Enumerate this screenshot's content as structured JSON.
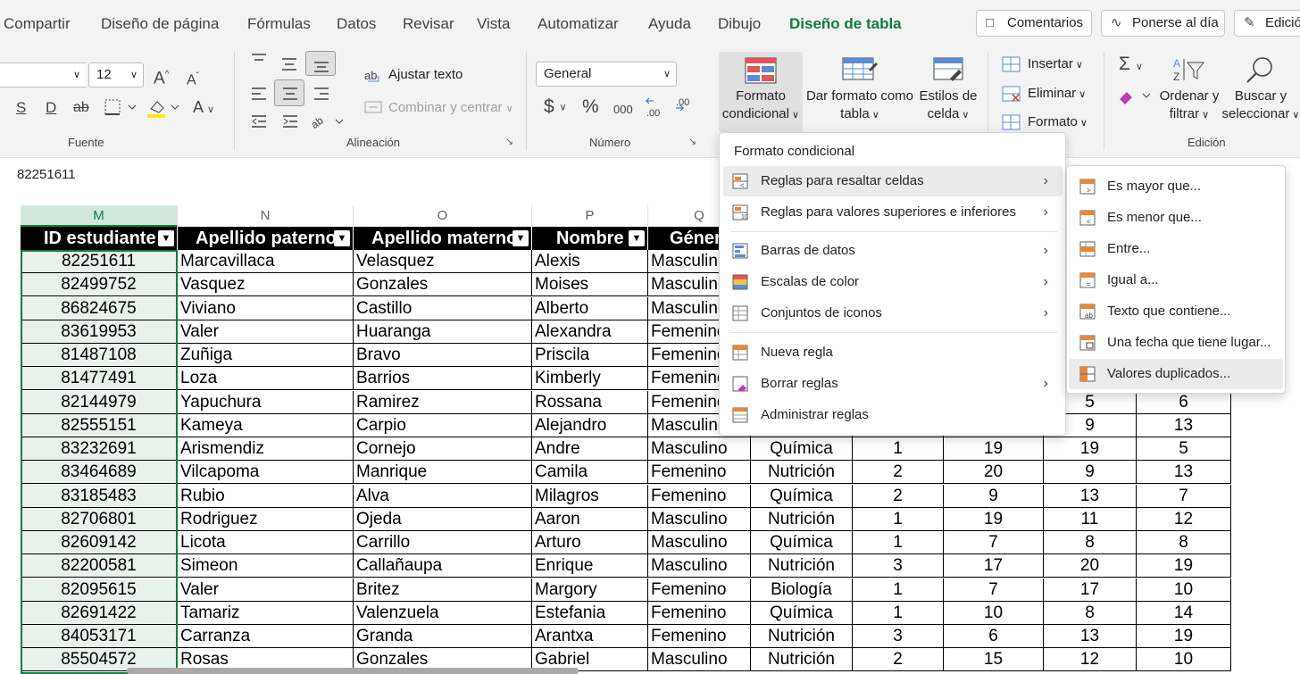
{
  "menubar": {
    "tabs": [
      "Compartir",
      "Diseño de página",
      "Fórmulas",
      "Datos",
      "Revisar",
      "Vista",
      "Automatizar",
      "Ayuda",
      "Dibujo",
      "Diseño de tabla"
    ],
    "active_tab": "Diseño de tabla",
    "comments_label": "Comentarios",
    "catchup_label": "Ponerse al día",
    "edit_label": "Edición"
  },
  "ribbon": {
    "font": {
      "name_value": "",
      "size_value": "12",
      "grow_glyph": "A",
      "shrink_glyph": "A",
      "underline_glyph": "S",
      "double_underline_glyph": "D",
      "strike_glyph": "ab",
      "font_color_glyph": "A",
      "group_label": "Fuente"
    },
    "alignment": {
      "wrap_text": "Ajustar texto",
      "merge_center": "Combinar y centrar",
      "group_label": "Alineación"
    },
    "number": {
      "format_value": "General",
      "currency_glyph": "$",
      "percent_glyph": "%",
      "thousands_glyph": "000",
      "group_label": "Número"
    },
    "styles": {
      "conditional_line1": "Formato",
      "conditional_line2": "condicional",
      "format_table_line1": "Dar formato como",
      "format_table_line2": "tabla",
      "cell_styles_line1": "Estilos de",
      "cell_styles_line2": "celda"
    },
    "cells": {
      "insert": "Insertar",
      "delete": "Eliminar",
      "format": "Formato"
    },
    "editing": {
      "sort_line1": "Ordenar y",
      "sort_line2": "filtrar",
      "find_line1": "Buscar y",
      "find_line2": "seleccionar",
      "group_label": "Edición"
    }
  },
  "formula_bar": {
    "value": "82251611"
  },
  "grid": {
    "columns": [
      "M",
      "N",
      "O",
      "P",
      "Q"
    ],
    "selected_column": "M",
    "headers": [
      "ID estudiante",
      "Apellido paterno",
      "Apellido materno",
      "Nombre",
      "Género"
    ],
    "rows": [
      [
        "82251611",
        "Marcavillaca",
        "Velasquez",
        "Alexis",
        "Masculino",
        "",
        "",
        "",
        "",
        ""
      ],
      [
        "82499752",
        "Vasquez",
        "Gonzales",
        "Moises",
        "Masculino",
        "",
        "",
        "",
        "",
        ""
      ],
      [
        "86824675",
        "Viviano",
        "Castillo",
        "Alberto",
        "Masculino",
        "",
        "",
        "",
        "",
        ""
      ],
      [
        "83619953",
        "Valer",
        "Huaranga",
        "Alexandra",
        "Femenino",
        "",
        "",
        "",
        "",
        ""
      ],
      [
        "81487108",
        "Zuñiga",
        "Bravo",
        "Priscila",
        "Femenino",
        "",
        "",
        "",
        "",
        ""
      ],
      [
        "81477491",
        "Loza",
        "Barrios",
        "Kimberly",
        "Femenino",
        "",
        "",
        "",
        "",
        ""
      ],
      [
        "82144979",
        "Yapuchura",
        "Ramirez",
        "Rossana",
        "Femenino",
        "",
        "",
        "",
        "5",
        "6"
      ],
      [
        "82555151",
        "Kameya",
        "Carpio",
        "Alejandro",
        "Masculino",
        "",
        "",
        "",
        "9",
        "13"
      ],
      [
        "83232691",
        "Arismendiz",
        "Cornejo",
        "Andre",
        "Masculino",
        "Química",
        "1",
        "19",
        "19",
        "5"
      ],
      [
        "83464689",
        "Vilcapoma",
        "Manrique",
        "Camila",
        "Femenino",
        "Nutrición",
        "2",
        "20",
        "9",
        "13"
      ],
      [
        "83185483",
        "Rubio",
        "Alva",
        "Milagros",
        "Femenino",
        "Química",
        "2",
        "9",
        "13",
        "7"
      ],
      [
        "82706801",
        "Rodriguez",
        "Ojeda",
        "Aaron",
        "Masculino",
        "Nutrición",
        "1",
        "19",
        "11",
        "12"
      ],
      [
        "82609142",
        "Licota",
        "Carrillo",
        "Arturo",
        "Masculino",
        "Química",
        "1",
        "7",
        "8",
        "8"
      ],
      [
        "82200581",
        "Simeon",
        "Callañaupa",
        "Enrique",
        "Masculino",
        "Nutrición",
        "3",
        "17",
        "20",
        "19"
      ],
      [
        "82095615",
        "Valer",
        "Britez",
        "Margory",
        "Femenino",
        "Biología",
        "1",
        "7",
        "17",
        "10"
      ],
      [
        "82691422",
        "Tamariz",
        "Valenzuela",
        "Estefania",
        "Femenino",
        "Química",
        "1",
        "10",
        "8",
        "14"
      ],
      [
        "84053171",
        "Carranza",
        "Granda",
        "Arantxa",
        "Femenino",
        "Nutrición",
        "3",
        "6",
        "13",
        "19"
      ],
      [
        "85504572",
        "Rosas",
        "Gonzales",
        "Gabriel",
        "Masculino",
        "Nutrición",
        "2",
        "15",
        "12",
        "10"
      ]
    ]
  },
  "cf_menu": {
    "title": "Formato condicional",
    "items": [
      {
        "label": "Reglas para resaltar celdas",
        "submenu": true
      },
      {
        "label": "Reglas para valores superiores e inferiores",
        "submenu": true
      },
      {
        "label": "Barras de datos",
        "submenu": true
      },
      {
        "label": "Escalas de color",
        "submenu": true
      },
      {
        "label": "Conjuntos de iconos",
        "submenu": true
      },
      {
        "label": "Nueva regla",
        "submenu": false
      },
      {
        "label": "Borrar reglas",
        "submenu": true
      },
      {
        "label": "Administrar reglas",
        "submenu": false
      }
    ],
    "submenu_items": [
      "Es mayor que...",
      "Es menor que...",
      "Entre...",
      "Igual a...",
      "Texto que contiene...",
      "Una fecha que tiene lugar...",
      "Valores duplicados..."
    ]
  },
  "colors": {
    "accent": "#107c41",
    "header_bg": "#000000",
    "selection_fill": "#e8f2ec"
  }
}
